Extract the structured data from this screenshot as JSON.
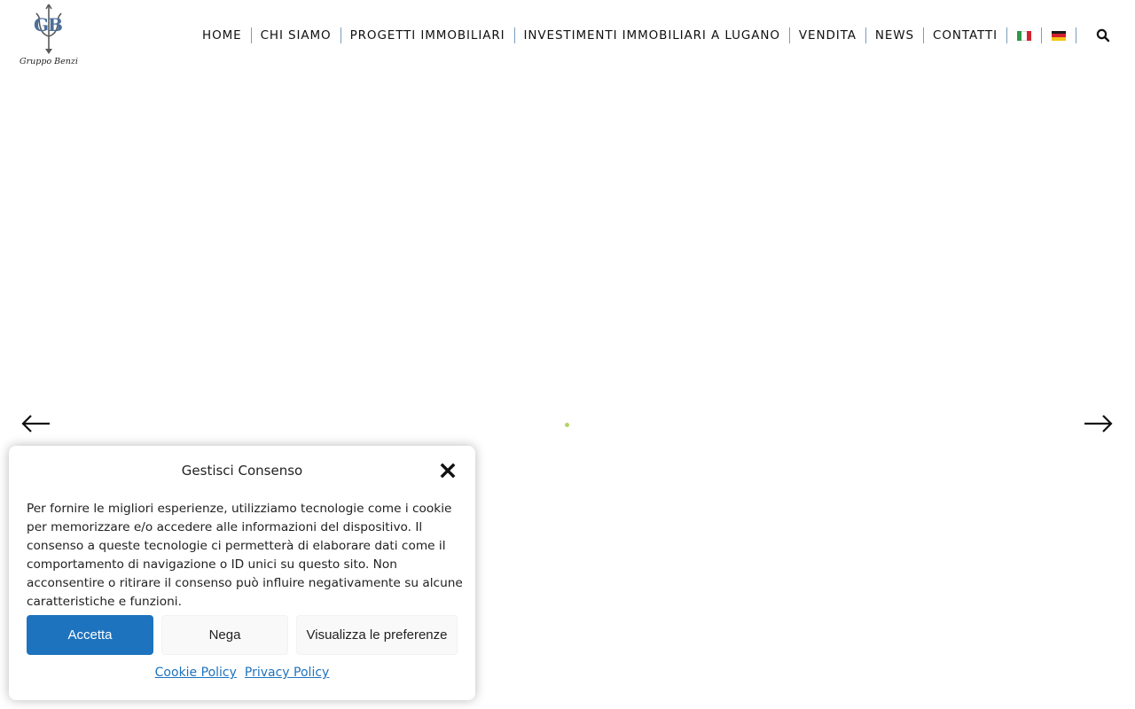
{
  "logo": {
    "monogram": "GB",
    "text": "Gruppo Benzi"
  },
  "nav": {
    "items": [
      {
        "label": "HOME"
      },
      {
        "label": "CHI SIAMO"
      },
      {
        "label": "PROGETTI IMMOBILIARI"
      },
      {
        "label": "INVESTIMENTI IMMOBILIARI A LUGANO"
      },
      {
        "label": "VENDITA"
      },
      {
        "label": "NEWS"
      },
      {
        "label": "CONTATTI"
      }
    ],
    "languages": [
      {
        "code": "it",
        "icon": "italian-flag-icon"
      },
      {
        "code": "de",
        "icon": "german-flag-icon"
      }
    ],
    "search_icon": "search-icon"
  },
  "slider": {
    "prev_icon": "arrow-left-icon",
    "next_icon": "arrow-right-icon",
    "loader_color": "#b8d36a"
  },
  "consent": {
    "title": "Gestisci Consenso",
    "body": "Per fornire le migliori esperienze, utilizziamo tecnologie come i cookie per memorizzare e/o accedere alle informazioni del dispositivo. Il consenso a queste tecnologie ci permetterà di elaborare dati come il comportamento di navigazione o ID unici su questo sito. Non acconsentire o ritirare il consenso può influire negativamente su alcune caratteristiche e funzioni.",
    "accept_label": "Accetta",
    "deny_label": "Nega",
    "prefs_label": "Visualizza le preferenze",
    "cookie_policy_label": "Cookie Policy",
    "privacy_policy_label": "Privacy Policy",
    "accent_color": "#1e73be"
  }
}
